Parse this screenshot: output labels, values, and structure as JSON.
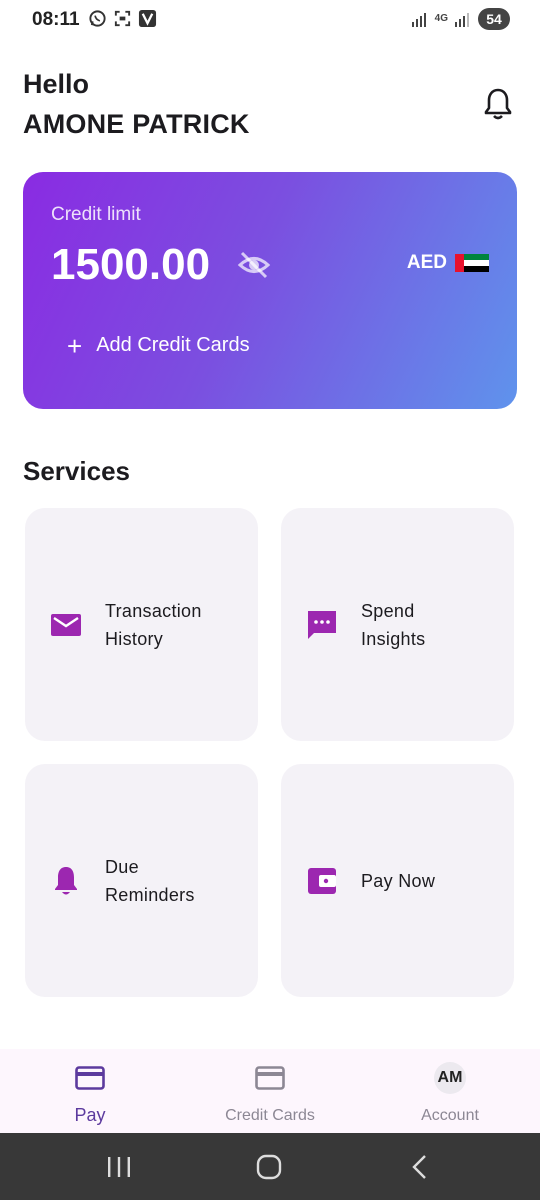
{
  "status_bar": {
    "time": "08:11",
    "battery": "54",
    "network_label": "4G",
    "icons": [
      "whatsapp-icon",
      "screenshot-icon",
      "vpn-icon",
      "signal-icon",
      "signal-icon",
      "battery-icon"
    ]
  },
  "header": {
    "greeting": "Hello",
    "user_name": "AMONE PATRICK",
    "notification_icon": "bell-icon"
  },
  "credit_card": {
    "label": "Credit limit",
    "amount": "1500.00",
    "visibility_icon": "eye-off-icon",
    "currency": "AED",
    "flag_icon": "uae-flag-icon",
    "add_cards_label": "Add Credit Cards",
    "gradient": [
      "#8a2be2",
      "#5f93ec"
    ]
  },
  "services": {
    "title": "Services",
    "items": [
      {
        "label": "Transaction\nHistory",
        "icon": "mail-icon"
      },
      {
        "label": "Spend\nInsights",
        "icon": "chat-bubble-icon"
      },
      {
        "label": "Due\nReminders",
        "icon": "bell-icon"
      },
      {
        "label": "Pay Now",
        "icon": "wallet-icon"
      }
    ]
  },
  "bottom_nav": {
    "items": [
      {
        "label": "Pay",
        "icon": "credit-card-icon",
        "active": true
      },
      {
        "label": "Credit Cards",
        "icon": "credit-card-icon",
        "active": false
      },
      {
        "label": "Account",
        "avatar": "AM",
        "active": false
      }
    ]
  },
  "colors": {
    "accent": "#9c27b0",
    "nav_active": "#5c3a9e",
    "tile_bg": "#f4f2f7"
  }
}
